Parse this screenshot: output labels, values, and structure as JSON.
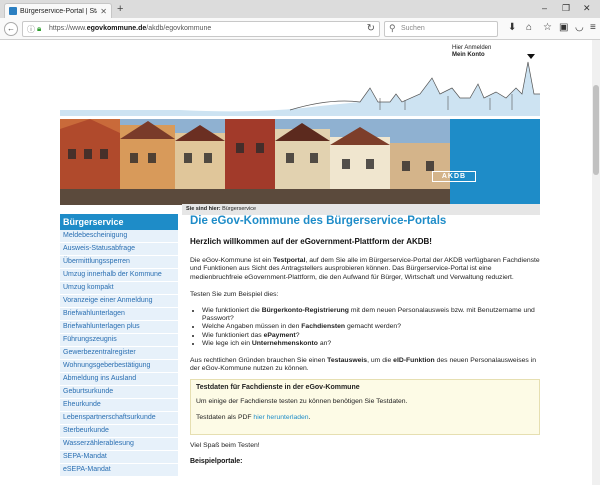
{
  "browser": {
    "tab_title": "Bürgerservice-Portal | Stad...",
    "tab_close": "✕",
    "new_tab": "+",
    "url_prefix": "https://www.",
    "url_domain": "egovkommune.de",
    "url_path": "/akdb/egovkommune",
    "search_placeholder": "Suchen",
    "window_controls": [
      "–",
      "❐",
      "✕"
    ]
  },
  "header": {
    "login_line1": "Hier Anmelden",
    "login_line2": "Mein Konto",
    "logo_text": "AKDB"
  },
  "breadcrumb": {
    "label": "Sie sind hier:",
    "current": "Bürgerservice"
  },
  "sidebar": {
    "heading": "Bürgerservice",
    "items": [
      "Meldebescheinigung",
      "Ausweis-Statusabfrage",
      "Übermittlungssperren",
      "Umzug innerhalb der Kommune",
      "Umzug kompakt",
      "Voranzeige einer Anmeldung",
      "Briefwahlunterlagen",
      "Briefwahlunterlagen plus",
      "Führungszeugnis",
      "Gewerbezentralregister",
      "Wohnungsgeberbestätigung",
      "Abmeldung ins Ausland",
      "Geburtsurkunde",
      "Eheurkunde",
      "Lebenspartnerschaftsurkunde",
      "Sterbeurkunde",
      "Wasserzählerablesung",
      "SEPA-Mandat",
      "eSEPA-Mandat"
    ]
  },
  "main": {
    "title": "Die eGov-Kommune des Bürgerservice-Portals",
    "subtitle": "Herzlich willkommen auf der eGovernment-Plattform der AKDB!",
    "intro_a": "Die eGov-Kommune ist ein ",
    "intro_b": "Testportal",
    "intro_c": ", auf dem Sie alle im Bürgerservice-Portal der AKDB verfügbaren Fachdienste und Funktionen aus Sicht des Antragstellers ausprobieren können. Das Bürgerservice-Portal ist eine medienbruchfreie eGovernment-Plattform, die den Aufwand für Bürger, Wirtschaft und Verwaltung reduziert.",
    "try_text": "Testen Sie zum Beispiel dies:",
    "bullets": [
      {
        "a": "Wie funktioniert die ",
        "b": "Bürgerkonto-Registrierung",
        "c": " mit dem neuen Personalausweis bzw. mit Benutzername und Passwort?"
      },
      {
        "a": "Welche Angaben müssen in den ",
        "b": "Fachdiensten",
        "c": " gemacht werden?"
      },
      {
        "a": "Wie funktioniert das ",
        "b": "ePayment",
        "c": "?"
      },
      {
        "a": "Wie lege ich ein ",
        "b": "Unternehmenskonto",
        "c": " an?"
      }
    ],
    "legal_a": "Aus rechtlichen Gründen brauchen Sie einen ",
    "legal_b": "Testausweis",
    "legal_c": ", um die ",
    "legal_d": "eID-Funktion",
    "legal_e": " des neuen Personalausweises in der eGov-Kommune nutzen zu können.",
    "testbox": {
      "title": "Testdaten für Fachdienste in der eGov-Kommune",
      "text1": "Um einige der Fachdienste testen zu können benötigen Sie Testdaten.",
      "text2_a": "Testdaten als PDF ",
      "text2_link": "hier herunterladen",
      "text2_b": "."
    },
    "fun_text": "Viel Spaß beim Testen!",
    "examples_heading": "Beispielportale:"
  },
  "colors": {
    "accent": "#1e8cc8",
    "sidebar_bg": "#e7f1fa",
    "sidebar_text": "#2a6fb2",
    "testbox_bg": "#fdfbe6"
  }
}
